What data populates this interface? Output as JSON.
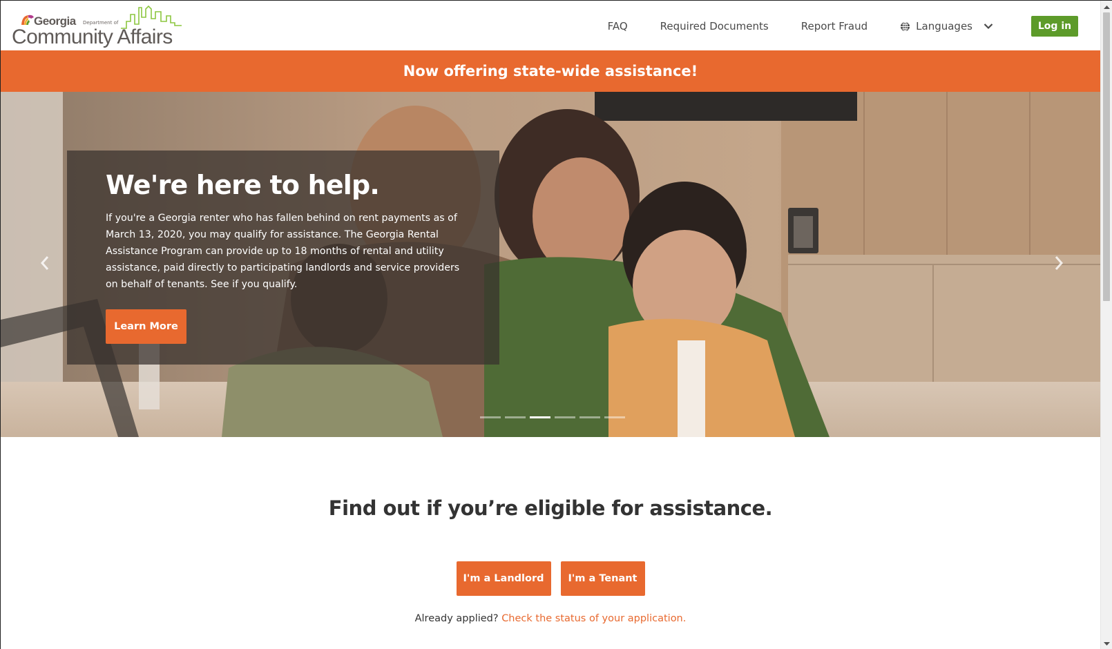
{
  "header": {
    "logo": {
      "state": "Georgia",
      "registered": "®",
      "department": "Department of",
      "name": "Community Affairs"
    },
    "nav": [
      {
        "label": "FAQ"
      },
      {
        "label": "Required Documents"
      },
      {
        "label": "Report Fraud"
      }
    ],
    "languages_label": "Languages",
    "login_label": "Log in"
  },
  "banner": {
    "text": "Now offering state-wide assistance!"
  },
  "hero": {
    "title": "We're here to help.",
    "body": "If you're a Georgia renter who has fallen behind on rent payments as of March 13, 2020, you may qualify for assistance. The Georgia Rental Assistance Program can provide up to 18 months of rental and utility assistance, paid directly to participating landlords and service providers on behalf of tenants. See if you qualify.",
    "cta_label": "Learn More",
    "slide_count": 6,
    "active_slide": 3
  },
  "eligibility": {
    "title": "Find out if you’re eligible for assistance.",
    "landlord_label": "I'm a Landlord",
    "tenant_label": "I'm a Tenant",
    "already_applied": "Already applied?",
    "status_link": "Check the status of your application."
  },
  "colors": {
    "accent_orange": "#e8692f",
    "login_green": "#5d9b2a",
    "text_dark": "#333333"
  }
}
